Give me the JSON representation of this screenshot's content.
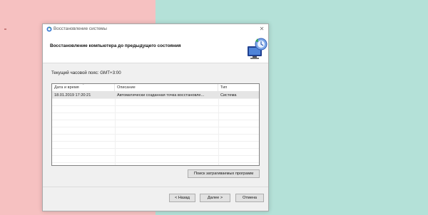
{
  "window": {
    "title": "Восстановление системы",
    "close_glyph": "✕"
  },
  "header": {
    "title": "Восстановление компьютера до предыдущего состояния",
    "graphic_icon": "system-restore-graphic"
  },
  "timezone_label": "Текущий часовой пояс: GMT+3:00",
  "table": {
    "columns": [
      "Дата и время",
      "Описание",
      "Тип"
    ],
    "rows": [
      {
        "date": "18.01.2019 17:20:21",
        "description": "Автоматически созданная точка восстановле...",
        "type": "Система",
        "selected": true
      }
    ]
  },
  "buttons": {
    "scan": "Поиск затрагиваемых программ",
    "back": "< Назад",
    "next": "Далее >",
    "cancel": "Отмена"
  },
  "colors": {
    "background_left": "#f6c1c1",
    "background_right": "#b4e1d8",
    "dialog_bg": "#f0f0f0",
    "selected_row": "#e5e5e5"
  }
}
